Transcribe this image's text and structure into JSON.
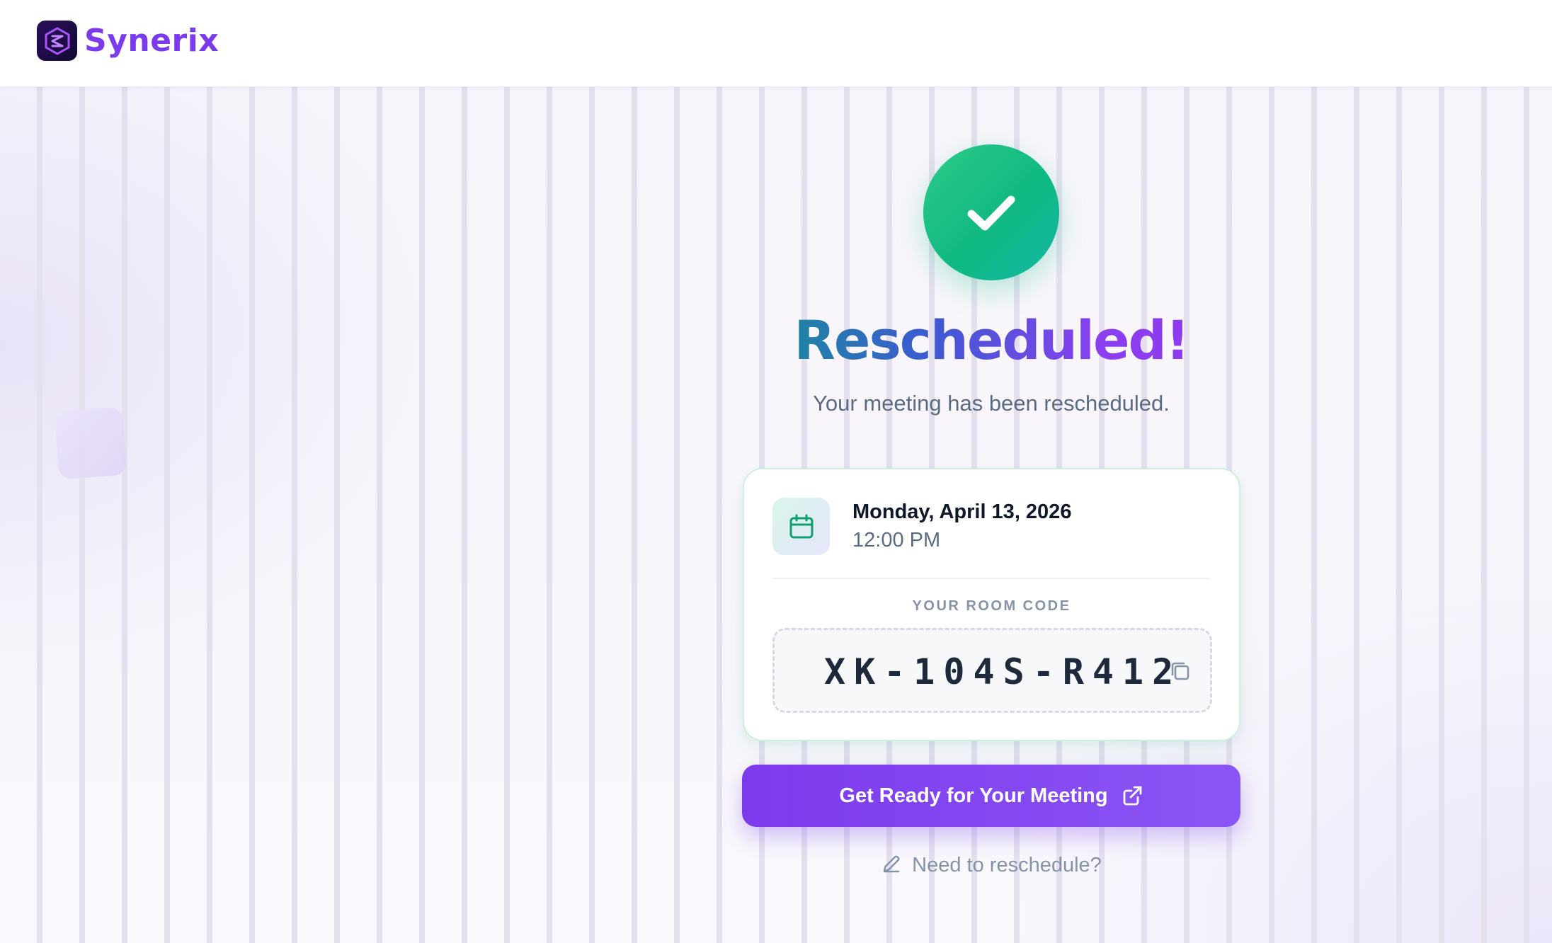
{
  "app": {
    "name": "Synerix"
  },
  "confirmation": {
    "title": "Rescheduled!",
    "subtitle": "Your meeting has been rescheduled."
  },
  "meeting": {
    "date": "Monday, April 13, 2026",
    "time": "12:00 PM",
    "room_code_label": "YOUR ROOM CODE",
    "room_code": "XK-104S-R412"
  },
  "actions": {
    "primary_label": "Get Ready for Your Meeting",
    "reschedule_label": "Need to reschedule?"
  },
  "icons": {
    "logo": "synerix-logo-icon",
    "success": "check-icon",
    "calendar": "calendar-icon",
    "copy": "copy-icon",
    "external": "external-link-icon",
    "edit": "pencil-icon"
  },
  "colors": {
    "brand": "#7c3aed",
    "success": "#10b981",
    "text_primary": "#0f172a",
    "text_muted": "#5b6b82"
  }
}
